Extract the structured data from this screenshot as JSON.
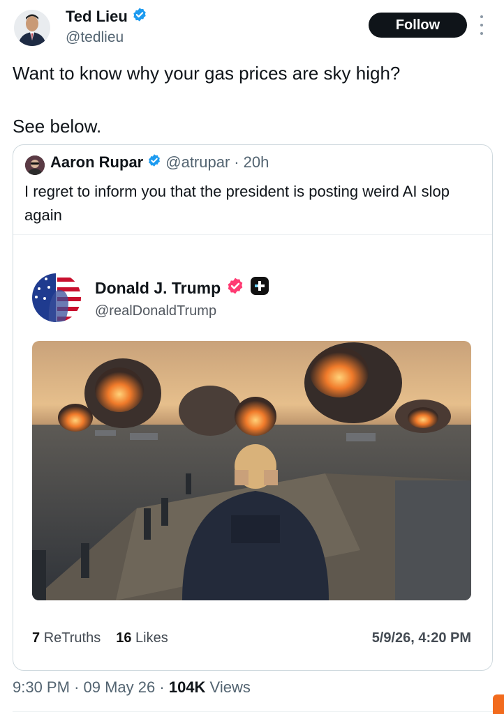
{
  "author": {
    "name": "Ted Lieu",
    "handle": "@tedlieu",
    "verified_icon": "verified-badge-icon",
    "follow_label": "Follow"
  },
  "tweet": {
    "line1": "Want to know why your gas prices are sky high?",
    "line2": "See below."
  },
  "quoted": {
    "name": "Aaron Rupar",
    "handle": "@atrupar",
    "separator": "·",
    "time": "20h",
    "text": "I regret to inform you that the president is posting weird AI slop again"
  },
  "truth_post": {
    "name": "Donald J. Trump",
    "handle": "@realDonaldTrump",
    "image_description": "AI image: man in suit on warship deck with binoculars watching burning ships",
    "retruths_count": "7",
    "retruths_label": "ReTruths",
    "likes_count": "16",
    "likes_label": "Likes",
    "date": "5/9/26, 4:20 PM"
  },
  "footer": {
    "time": "9:30 PM",
    "sep": "·",
    "date": "09 May 26",
    "views_count": "104K",
    "views_label": "Views"
  },
  "colors": {
    "verified_blue": "#1d9bf0",
    "truth_badge_pink": "#ff3b73",
    "follow_bg": "#0f1419",
    "muted": "#536471"
  }
}
